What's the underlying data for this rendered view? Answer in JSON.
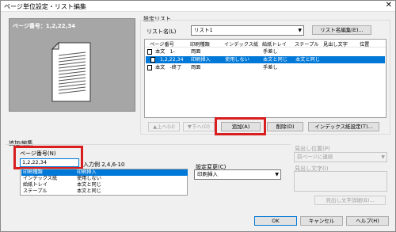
{
  "window": {
    "title": "ページ単位設定・リスト編集",
    "close_glyph": "✕"
  },
  "preview": {
    "page_number_text": "ページ番号：1,2,22,34"
  },
  "settings_list": {
    "section_label": "設定リスト",
    "list_name_label": "リスト名(L)",
    "list_name_value": "リスト1",
    "list_name_edit_button": "リスト名編集(E)...",
    "columns": [
      "ページ番号",
      "印刷種類",
      "インデックス紙",
      "給紙トレイ",
      "ステープル",
      "見出し文字",
      "位置"
    ],
    "rows": [
      {
        "page": "本文　1-",
        "type": "両面",
        "index": "",
        "tray": "手差し",
        "staple": "",
        "heading": "",
        "pos": ""
      },
      {
        "page": "1,2,22,34",
        "type": "印刷挿入",
        "index": "使用しない",
        "tray": "本文と同じ",
        "staple": "本文と同じ",
        "heading": "",
        "pos": ""
      },
      {
        "page": "本文　-終了",
        "type": "両面",
        "index": "",
        "tray": "手差し",
        "staple": "",
        "heading": "",
        "pos": ""
      }
    ],
    "up_button": "▲上へ(U)",
    "down_button": "▼下へ(O)",
    "add_button": "追加(A)",
    "delete_button": "削除(D)",
    "index_settings_button": "インデックス紙設定(T)..."
  },
  "add_edit": {
    "section_label": "追加/編集",
    "page_number_label": "ページ番号(N)",
    "page_number_value": "1,2,22,34",
    "input_example": "入力例 2,4,6-10",
    "settings": [
      {
        "key": "印刷種類",
        "value": "印刷挿入"
      },
      {
        "key": "インデックス紙",
        "value": "使用しない"
      },
      {
        "key": "給紙トレイ",
        "value": "本文と同じ"
      },
      {
        "key": "ステープル",
        "value": "本文と同じ"
      }
    ],
    "change_settings_label": "設定変更(C)",
    "change_settings_value": "印刷挿入",
    "heading_position_label": "見出し位置(P)",
    "heading_position_value": "前ページに連続",
    "heading_text_label": "見出し文字(I)",
    "heading_text_settings_button": "見出し文字詳細(B)..."
  },
  "footer": {
    "ok_button": "OK",
    "cancel_button": "キャンセル",
    "help_button": "ヘルプ(H)"
  },
  "colors": {
    "selection": "#0078d7",
    "highlight_box": "#d81e1e",
    "window_bg": "#f0f0f0"
  }
}
